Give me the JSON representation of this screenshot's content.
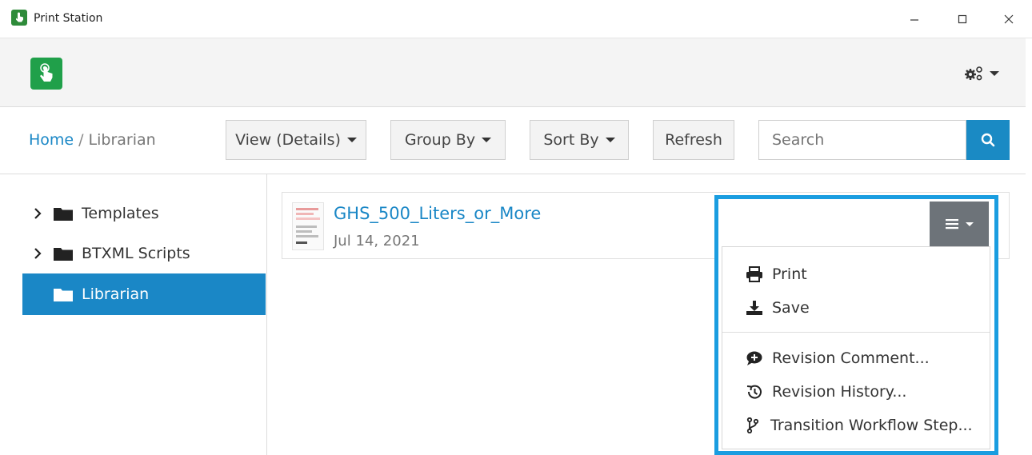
{
  "window": {
    "title": "Print Station",
    "minimize": "–",
    "maximize": "☐",
    "close": "✕"
  },
  "breadcrumb": {
    "home": "Home",
    "separator": "/",
    "current": "Librarian"
  },
  "toolbar": {
    "view_label": "View (Details)",
    "group_label": "Group By",
    "sort_label": "Sort By",
    "refresh_label": "Refresh",
    "search_placeholder": "Search"
  },
  "sidebar": {
    "items": [
      {
        "label": "Templates",
        "expandable": true,
        "active": false
      },
      {
        "label": "BTXML Scripts",
        "expandable": true,
        "active": false
      },
      {
        "label": "Librarian",
        "expandable": false,
        "active": true
      }
    ]
  },
  "document": {
    "name": "GHS_500_Liters_or_More",
    "date": "Jul 14, 2021"
  },
  "menu": {
    "items": [
      {
        "label": "Print",
        "icon": "printer-icon"
      },
      {
        "label": "Save",
        "icon": "download-icon"
      },
      {
        "label": "Revision Comment...",
        "icon": "comment-plus-icon"
      },
      {
        "label": "Revision History...",
        "icon": "history-icon"
      },
      {
        "label": "Transition Workflow Step...",
        "icon": "workflow-branch-icon"
      }
    ]
  },
  "colors": {
    "accent": "#1a87c6",
    "highlight_frame": "#1a9de0",
    "menu_toggle": "#6d7379",
    "logo_green": "#20a04a"
  }
}
